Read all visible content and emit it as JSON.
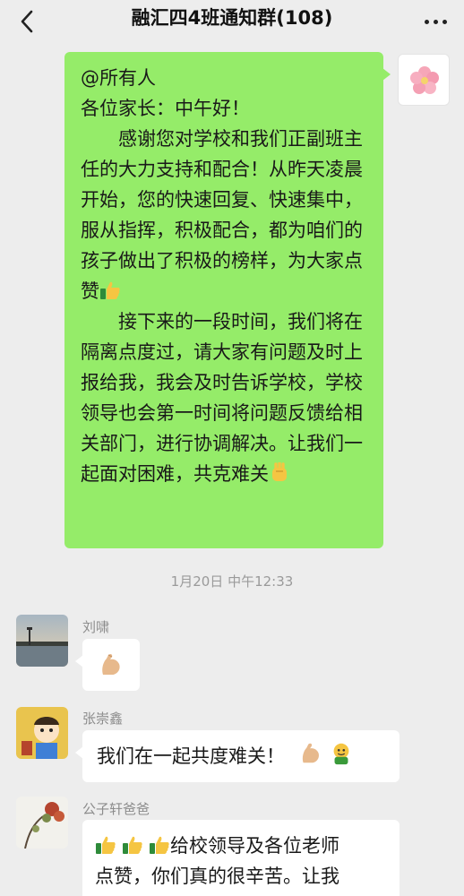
{
  "header": {
    "title": "融汇四4班通知群(108)",
    "back_icon": "back-chevron-icon",
    "more_icon": "more-dots-icon"
  },
  "messages": [
    {
      "sender": "me",
      "lines": [
        "@所有人",
        "各位家长：中午好！",
        "感谢您对学校和我们正副班主任的大力支持和配合！从昨天凌晨开始，您的快速回复、快速集中，服从指挥，积极配合，都为咱们的孩子做出了积极的榜样，为大家点赞",
        "接下来的一段时间，我们将在隔离点度过，请大家有问题及时上报给我，我会及时告诉学校，学校领导也会第一时间将问题反馈给相关部门，进行协调解决。让我们一起面对困难，共克难关"
      ]
    },
    {
      "timestamp": "1月20日 中午12:33"
    },
    {
      "sender": "刘啸",
      "text": ""
    },
    {
      "sender": "张崇鑫",
      "text": "我们在一起共度难关！"
    },
    {
      "sender": "公子轩爸爸",
      "lines": [
        "给校领导及各位老师",
        "点赞，你们真的很辛苦。让我"
      ]
    }
  ],
  "colors": {
    "bg": "#ededed",
    "my_bubble": "#95ec69",
    "other_bubble": "#ffffff",
    "nick": "#8c8c8c"
  }
}
